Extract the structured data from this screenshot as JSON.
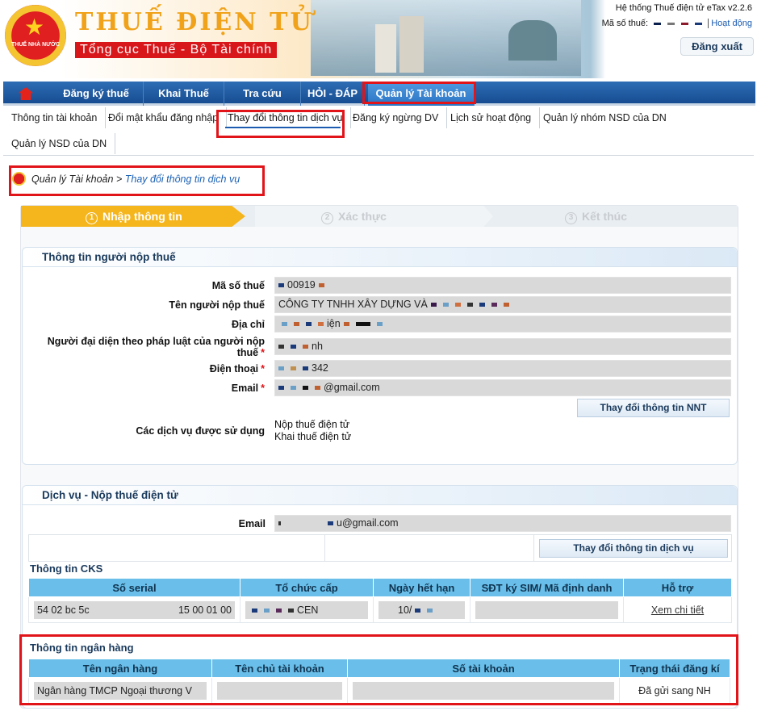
{
  "header": {
    "title": "THUẾ ĐIỆN TỬ",
    "subtitle": "Tổng cục Thuế - Bộ Tài chính",
    "emblem_text": "THUẾ NHÀ NƯỚC",
    "system": "Hệ thống Thuế điện tử eTax v2.2.6",
    "tax_code_label": "Mã số thuế:",
    "activity_link": "Hoạt động",
    "logout": "Đăng xuất"
  },
  "nav": {
    "items": [
      "Đăng ký thuế",
      "Khai Thuế",
      "Tra cứu",
      "HỎI - ĐÁP",
      "Quản lý Tài khoản"
    ]
  },
  "subnav": {
    "items": [
      "Thông tin tài khoản",
      "Đổi mật khẩu đăng nhập",
      "Thay đổi thông tin dịch vụ",
      "Đăng ký ngừng DV",
      "Lịch sử hoạt động",
      "Quản lý nhóm NSD của DN",
      "Quản lý NSD của DN"
    ]
  },
  "breadcrumb": {
    "parent": "Quản lý Tài khoản",
    "sep": ">",
    "current": "Thay đổi thông tin dịch vụ"
  },
  "steps": [
    {
      "num": "1",
      "label": "Nhập thông tin"
    },
    {
      "num": "2",
      "label": "Xác thực"
    },
    {
      "num": "3",
      "label": "Kết thúc"
    }
  ],
  "taxpayer": {
    "title": "Thông tin người nộp thuế",
    "labels": {
      "mst": "Mã số thuế",
      "name": "Tên người nộp thuế",
      "address": "Địa chỉ",
      "rep": "Người đại diện theo pháp luật của người nộp thuế",
      "phone": "Điện thoại",
      "email": "Email",
      "services": "Các dịch vụ được sử dụng"
    },
    "values": {
      "mst": "00919",
      "name": "CÔNG TY TNHH XÂY DỰNG VÀ",
      "address": "iện",
      "rep": "nh",
      "phone": "342",
      "email": "@gmail.com"
    },
    "services": [
      "Nộp thuế điện tử",
      "Khai thuế điện tử"
    ],
    "change_btn": "Thay đổi thông tin NNT"
  },
  "service": {
    "title": "Dịch vụ - Nộp thuế điện tử",
    "email_label": "Email",
    "email": "u@gmail.com",
    "change_btn": "Thay đổi thông tin dịch vụ"
  },
  "cks": {
    "title": "Thông tin CKS",
    "headers": [
      "Số serial",
      "Tổ chức cấp",
      "Ngày hết hạn",
      "SĐT ký SIM/ Mã định danh",
      "Hỗ trợ"
    ],
    "serial_a": "54 02 bc 5c",
    "serial_b": "15 00 01 00",
    "issuer": "CEN",
    "expiry": "10/",
    "support": "Xem chi tiết"
  },
  "bank": {
    "title": "Thông tin ngân hàng",
    "headers": [
      "Tên ngân hàng",
      "Tên chủ tài khoản",
      "Số tài khoản",
      "Trạng thái đăng kí"
    ],
    "bank_name": "Ngân hàng TMCP Ngoại thương V",
    "status": "Đã gửi sang NH"
  },
  "colors": {
    "nav": "#1f5ca5",
    "accent": "#f5b51c",
    "highlight": "#e1141a",
    "table_header": "#69bfe9"
  }
}
